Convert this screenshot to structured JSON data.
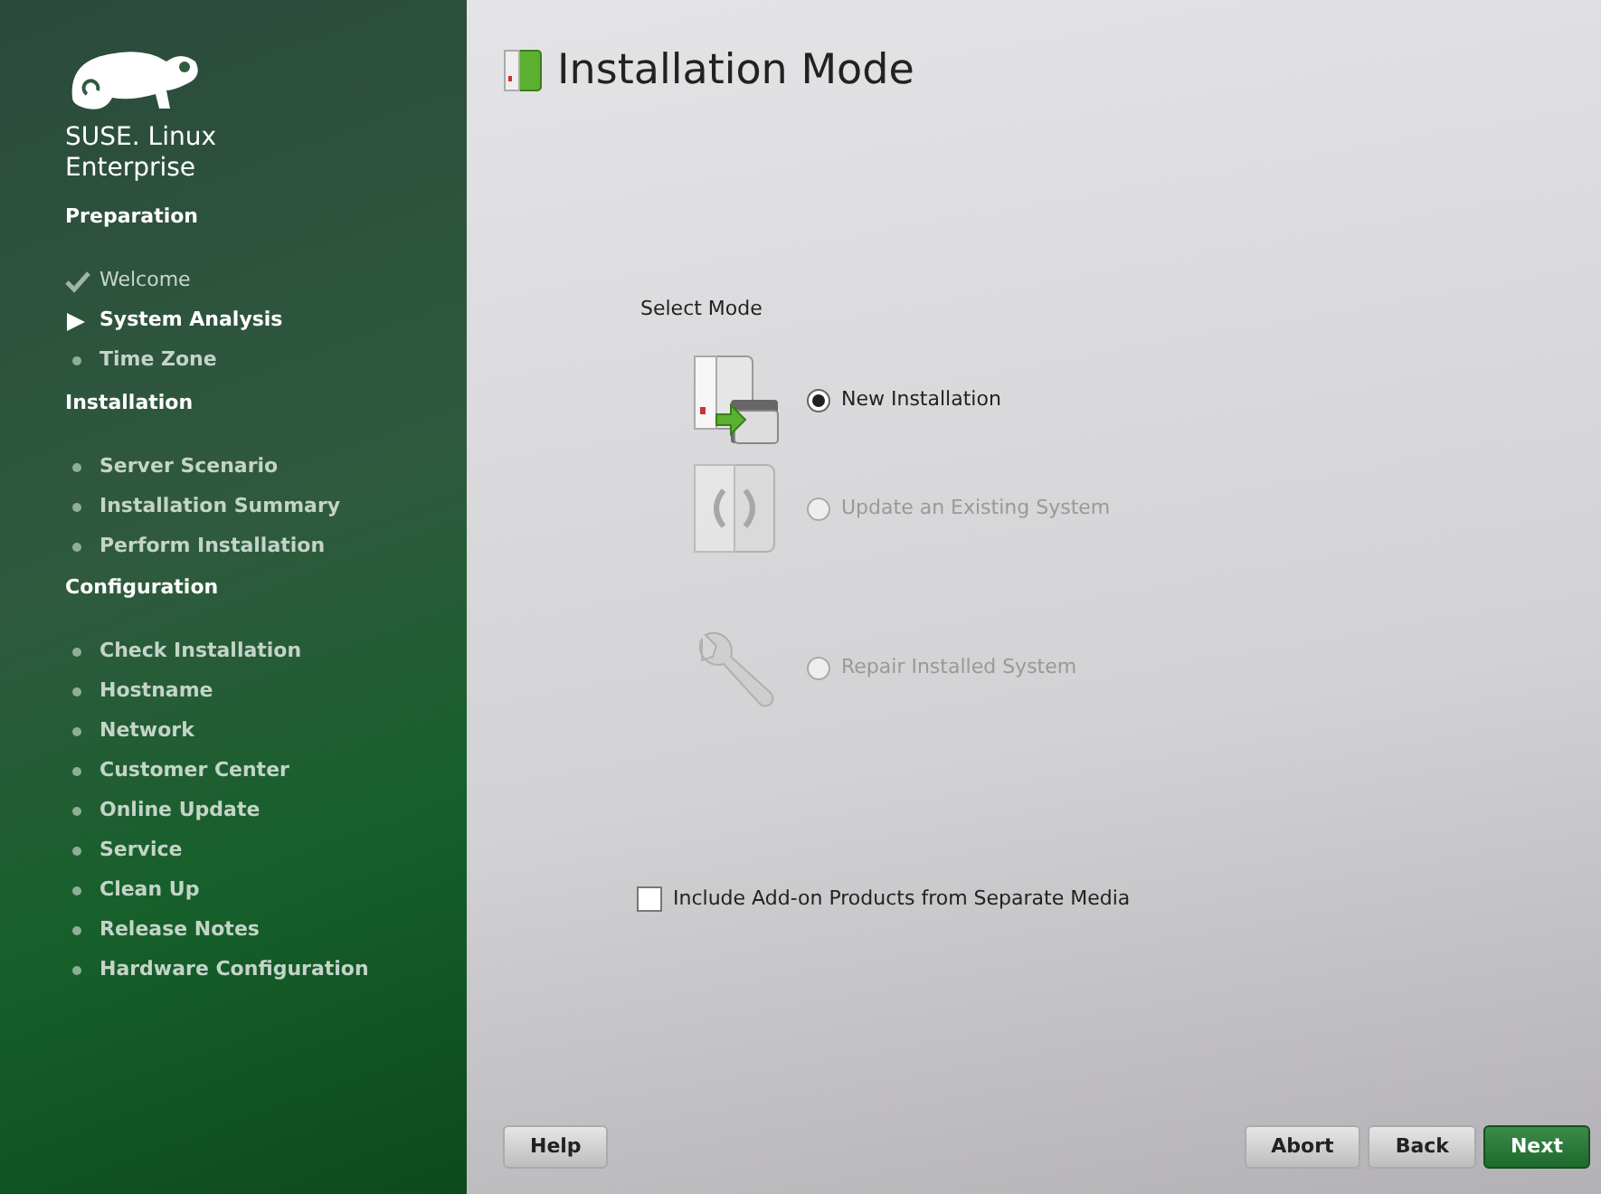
{
  "sidebar": {
    "brand": [
      "SUSE. Linux",
      "Enterprise"
    ],
    "sections": [
      {
        "title": "Preparation",
        "steps": [
          {
            "label": "Welcome",
            "kind": "done"
          },
          {
            "label": "System Analysis",
            "kind": "current"
          },
          {
            "label": "Time Zone",
            "kind": "pending"
          }
        ]
      },
      {
        "title": "Installation",
        "steps": [
          {
            "label": "Server Scenario",
            "kind": "pending"
          },
          {
            "label": "Installation Summary",
            "kind": "pending"
          },
          {
            "label": "Perform Installation",
            "kind": "pending"
          }
        ]
      },
      {
        "title": "Configuration",
        "steps": [
          {
            "label": "Check Installation",
            "kind": "pending"
          },
          {
            "label": "Hostname",
            "kind": "pending"
          },
          {
            "label": "Network",
            "kind": "pending"
          },
          {
            "label": "Customer Center",
            "kind": "pending"
          },
          {
            "label": "Online Update",
            "kind": "pending"
          },
          {
            "label": "Service",
            "kind": "pending"
          },
          {
            "label": "Clean Up",
            "kind": "pending"
          },
          {
            "label": "Release Notes",
            "kind": "pending"
          },
          {
            "label": "Hardware Configuration",
            "kind": "pending"
          }
        ]
      }
    ]
  },
  "title": "Installation Mode",
  "mode_group": {
    "label": "Select Mode",
    "options": [
      {
        "kind": "new",
        "label": "New Installation",
        "selected": true,
        "disabled": false
      },
      {
        "kind": "update",
        "label": "Update an Existing System",
        "selected": false,
        "disabled": true
      },
      {
        "kind": "repair",
        "label": "Repair Installed System",
        "selected": false,
        "disabled": true
      }
    ]
  },
  "addon_checkbox": {
    "label": "Include Add-on Products from Separate Media",
    "checked": false
  },
  "buttons": [
    {
      "label": "Help",
      "kind": "normal"
    },
    {
      "label": "Abort",
      "kind": "normal"
    },
    {
      "label": "Back",
      "kind": "normal"
    },
    {
      "label": "Next",
      "kind": "primary"
    }
  ]
}
